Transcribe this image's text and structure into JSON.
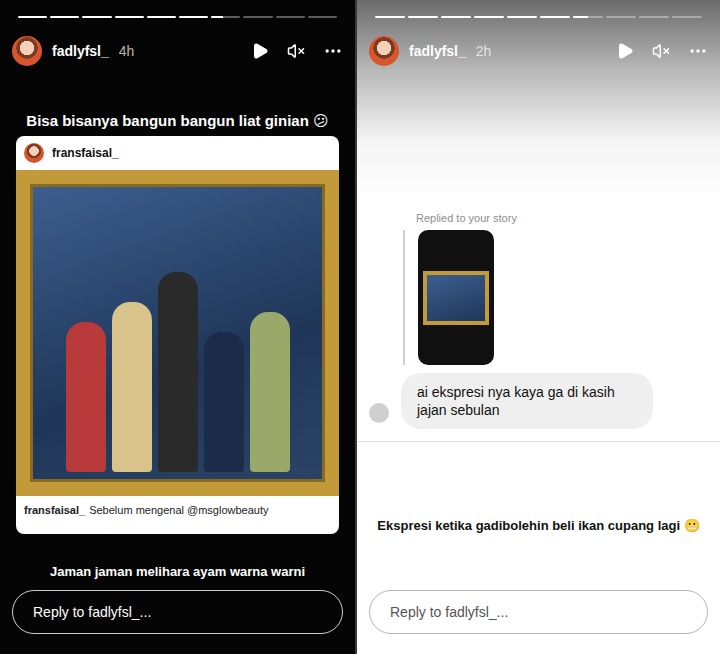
{
  "stories": [
    {
      "kind": "post-share",
      "theme": "dark",
      "user": "fadlyfsl_",
      "time": "4h",
      "progress": [
        1,
        1,
        1,
        1,
        1,
        1,
        0.4,
        0,
        0,
        0
      ],
      "caption": "Bisa bisanya bangun bangun liat ginian 😕",
      "post": {
        "user": "fransfaisal_",
        "caption_user": "fransfaisal_",
        "caption": "Sebelum mengenal @msglowbeauty"
      },
      "footer_text": "Jaman jaman melihara ayam warna warni",
      "reply_placeholder": "Reply to fadlyfsl_..."
    },
    {
      "kind": "reply-share",
      "theme": "light",
      "user": "fadlyfsl_",
      "time": "2h",
      "progress": [
        1,
        1,
        1,
        1,
        1,
        1,
        0.5,
        0,
        0,
        0
      ],
      "reply": {
        "label": "Replied to your story",
        "message": "ai ekspresi nya kaya ga di kasih jajan sebulan"
      },
      "caption": "Ekspresi ketika gadibolehin beli ikan cupang lagi 😬",
      "reply_placeholder": "Reply to fadlyfsl_..."
    }
  ]
}
